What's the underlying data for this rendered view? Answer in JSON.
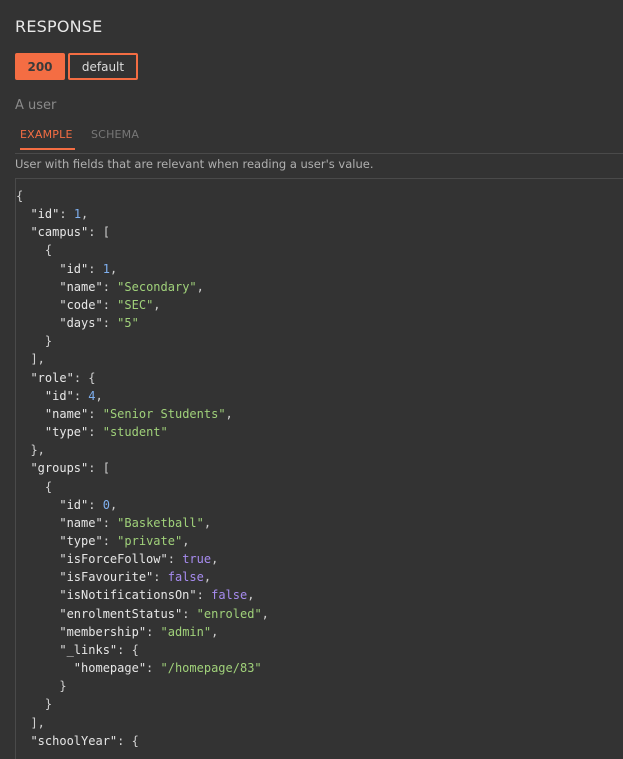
{
  "heading": "RESPONSE",
  "response_tabs": [
    {
      "label": "200",
      "active": true
    },
    {
      "label": "default",
      "active": false
    }
  ],
  "response_description": "A user",
  "sub_tabs": {
    "example": "EXAMPLE",
    "schema": "SCHEMA"
  },
  "panel_description": "User with fields that are relevant when reading a user's value.",
  "colors": {
    "accent": "#f46d43",
    "background": "#333333",
    "string": "#a0d17a",
    "number": "#7fb0ef",
    "boolean": "#a78cf0"
  },
  "code_lines": [
    [
      {
        "t": "{",
        "c": "p"
      }
    ],
    [
      {
        "t": "  "
      },
      {
        "t": "\"id\"",
        "c": "k"
      },
      {
        "t": ": ",
        "c": "p"
      },
      {
        "t": "1",
        "c": "n"
      },
      {
        "t": ",",
        "c": "p"
      }
    ],
    [
      {
        "t": "  "
      },
      {
        "t": "\"campus\"",
        "c": "k"
      },
      {
        "t": ": [",
        "c": "p"
      }
    ],
    [
      {
        "t": "    {",
        "c": "p"
      }
    ],
    [
      {
        "t": "      "
      },
      {
        "t": "\"id\"",
        "c": "k"
      },
      {
        "t": ": ",
        "c": "p"
      },
      {
        "t": "1",
        "c": "n"
      },
      {
        "t": ",",
        "c": "p"
      }
    ],
    [
      {
        "t": "      "
      },
      {
        "t": "\"name\"",
        "c": "k"
      },
      {
        "t": ": ",
        "c": "p"
      },
      {
        "t": "\"Secondary\"",
        "c": "s"
      },
      {
        "t": ",",
        "c": "p"
      }
    ],
    [
      {
        "t": "      "
      },
      {
        "t": "\"code\"",
        "c": "k"
      },
      {
        "t": ": ",
        "c": "p"
      },
      {
        "t": "\"SEC\"",
        "c": "s"
      },
      {
        "t": ",",
        "c": "p"
      }
    ],
    [
      {
        "t": "      "
      },
      {
        "t": "\"days\"",
        "c": "k"
      },
      {
        "t": ": ",
        "c": "p"
      },
      {
        "t": "\"5\"",
        "c": "s"
      }
    ],
    [
      {
        "t": "    }",
        "c": "p"
      }
    ],
    [
      {
        "t": "  ],",
        "c": "p"
      }
    ],
    [
      {
        "t": "  "
      },
      {
        "t": "\"role\"",
        "c": "k"
      },
      {
        "t": ": {",
        "c": "p"
      }
    ],
    [
      {
        "t": "    "
      },
      {
        "t": "\"id\"",
        "c": "k"
      },
      {
        "t": ": ",
        "c": "p"
      },
      {
        "t": "4",
        "c": "n"
      },
      {
        "t": ",",
        "c": "p"
      }
    ],
    [
      {
        "t": "    "
      },
      {
        "t": "\"name\"",
        "c": "k"
      },
      {
        "t": ": ",
        "c": "p"
      },
      {
        "t": "\"Senior Students\"",
        "c": "s"
      },
      {
        "t": ",",
        "c": "p"
      }
    ],
    [
      {
        "t": "    "
      },
      {
        "t": "\"type\"",
        "c": "k"
      },
      {
        "t": ": ",
        "c": "p"
      },
      {
        "t": "\"student\"",
        "c": "s"
      }
    ],
    [
      {
        "t": "  },",
        "c": "p"
      }
    ],
    [
      {
        "t": "  "
      },
      {
        "t": "\"groups\"",
        "c": "k"
      },
      {
        "t": ": [",
        "c": "p"
      }
    ],
    [
      {
        "t": "    {",
        "c": "p"
      }
    ],
    [
      {
        "t": "      "
      },
      {
        "t": "\"id\"",
        "c": "k"
      },
      {
        "t": ": ",
        "c": "p"
      },
      {
        "t": "0",
        "c": "n"
      },
      {
        "t": ",",
        "c": "p"
      }
    ],
    [
      {
        "t": "      "
      },
      {
        "t": "\"name\"",
        "c": "k"
      },
      {
        "t": ": ",
        "c": "p"
      },
      {
        "t": "\"Basketball\"",
        "c": "s"
      },
      {
        "t": ",",
        "c": "p"
      }
    ],
    [
      {
        "t": "      "
      },
      {
        "t": "\"type\"",
        "c": "k"
      },
      {
        "t": ": ",
        "c": "p"
      },
      {
        "t": "\"private\"",
        "c": "s"
      },
      {
        "t": ",",
        "c": "p"
      }
    ],
    [
      {
        "t": "      "
      },
      {
        "t": "\"isForceFollow\"",
        "c": "k"
      },
      {
        "t": ": ",
        "c": "p"
      },
      {
        "t": "true",
        "c": "b"
      },
      {
        "t": ",",
        "c": "p"
      }
    ],
    [
      {
        "t": "      "
      },
      {
        "t": "\"isFavourite\"",
        "c": "k"
      },
      {
        "t": ": ",
        "c": "p"
      },
      {
        "t": "false",
        "c": "b"
      },
      {
        "t": ",",
        "c": "p"
      }
    ],
    [
      {
        "t": "      "
      },
      {
        "t": "\"isNotificationsOn\"",
        "c": "k"
      },
      {
        "t": ": ",
        "c": "p"
      },
      {
        "t": "false",
        "c": "b"
      },
      {
        "t": ",",
        "c": "p"
      }
    ],
    [
      {
        "t": "      "
      },
      {
        "t": "\"enrolmentStatus\"",
        "c": "k"
      },
      {
        "t": ": ",
        "c": "p"
      },
      {
        "t": "\"enroled\"",
        "c": "s"
      },
      {
        "t": ",",
        "c": "p"
      }
    ],
    [
      {
        "t": "      "
      },
      {
        "t": "\"membership\"",
        "c": "k"
      },
      {
        "t": ": ",
        "c": "p"
      },
      {
        "t": "\"admin\"",
        "c": "s"
      },
      {
        "t": ",",
        "c": "p"
      }
    ],
    [
      {
        "t": "      "
      },
      {
        "t": "\"_links\"",
        "c": "k"
      },
      {
        "t": ": {",
        "c": "p"
      }
    ],
    [
      {
        "t": "        "
      },
      {
        "t": "\"homepage\"",
        "c": "k"
      },
      {
        "t": ": ",
        "c": "p"
      },
      {
        "t": "\"/homepage/83\"",
        "c": "s"
      }
    ],
    [
      {
        "t": "      }",
        "c": "p"
      }
    ],
    [
      {
        "t": "    }",
        "c": "p"
      }
    ],
    [
      {
        "t": "  ],",
        "c": "p"
      }
    ],
    [
      {
        "t": "  "
      },
      {
        "t": "\"schoolYear\"",
        "c": "k"
      },
      {
        "t": ": {",
        "c": "p"
      }
    ]
  ]
}
